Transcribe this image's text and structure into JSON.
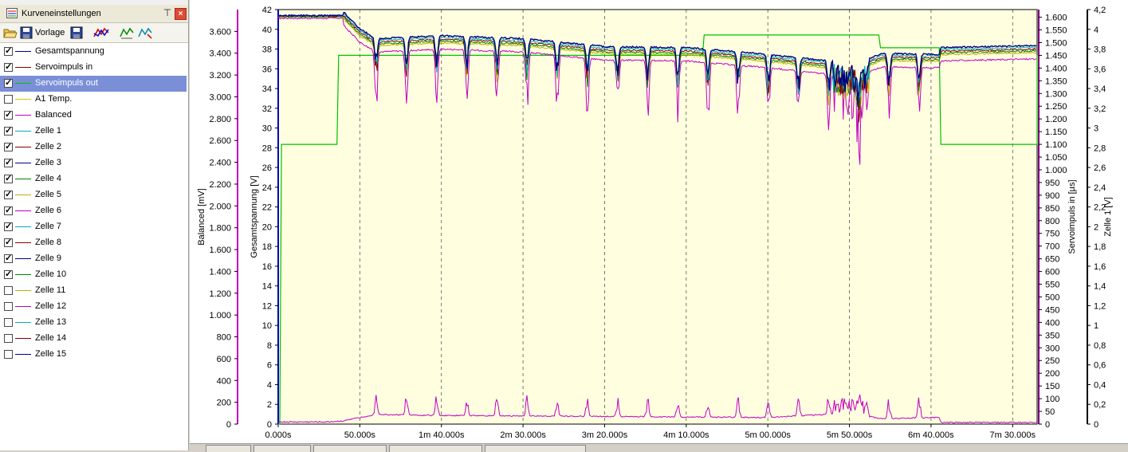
{
  "panel": {
    "title": "Kurveneinstellungen",
    "template_label": "Vorlage",
    "curves": [
      {
        "label": "Gesamtspannung",
        "checked": true,
        "color": "#000080"
      },
      {
        "label": "Servoimpuls in",
        "checked": true,
        "color": "#800000"
      },
      {
        "label": "Servoimpuls out",
        "checked": true,
        "color": "#00c000",
        "selected": true
      },
      {
        "label": "A1 Temp.",
        "checked": false,
        "color": "#e0c000"
      },
      {
        "label": "Balanced",
        "checked": true,
        "color": "#c000c0"
      },
      {
        "label": "Zelle 1",
        "checked": true,
        "color": "#00b0c0"
      },
      {
        "label": "Zelle 2",
        "checked": true,
        "color": "#800000"
      },
      {
        "label": "Zelle 3",
        "checked": true,
        "color": "#000080"
      },
      {
        "label": "Zelle 4",
        "checked": true,
        "color": "#008000"
      },
      {
        "label": "Zelle 5",
        "checked": true,
        "color": "#c0b000"
      },
      {
        "label": "Zelle 6",
        "checked": true,
        "color": "#c000c0"
      },
      {
        "label": "Zelle 7",
        "checked": true,
        "color": "#00b0c0"
      },
      {
        "label": "Zelle 8",
        "checked": true,
        "color": "#800000"
      },
      {
        "label": "Zelle 9",
        "checked": true,
        "color": "#000080"
      },
      {
        "label": "Zelle 10",
        "checked": true,
        "color": "#008000"
      },
      {
        "label": "Zelle 11",
        "checked": false,
        "color": "#c0b000"
      },
      {
        "label": "Zelle 12",
        "checked": false,
        "color": "#c000c0"
      },
      {
        "label": "Zelle 13",
        "checked": false,
        "color": "#00b0c0"
      },
      {
        "label": "Zelle 14",
        "checked": false,
        "color": "#800000"
      },
      {
        "label": "Zelle 15",
        "checked": false,
        "color": "#000080"
      }
    ]
  },
  "chart_data": {
    "type": "line",
    "background": "#ffffe0",
    "grid": "vertical dashed",
    "x_range": [
      0,
      465
    ],
    "x_ticks": [
      {
        "t": 0,
        "label": "0.000s"
      },
      {
        "t": 50,
        "label": "50.000s"
      },
      {
        "t": 100,
        "label": "1m 40.000s"
      },
      {
        "t": 150,
        "label": "2m 30.000s"
      },
      {
        "t": 200,
        "label": "3m 20.000s"
      },
      {
        "t": 250,
        "label": "4m 10.000s"
      },
      {
        "t": 300,
        "label": "5m 00.000s"
      },
      {
        "t": 350,
        "label": "5m 50.000s"
      },
      {
        "t": 400,
        "label": "6m 40.000s"
      },
      {
        "t": 450,
        "label": "7m 30.000s"
      }
    ],
    "axes": {
      "balanced": {
        "label": "Balanced [mV]",
        "range": [
          0,
          3800
        ],
        "color": "#c000c0",
        "ticks": [
          "0",
          "200",
          "400",
          "600",
          "800",
          "1.000",
          "1.200",
          "1.400",
          "1.600",
          "1.800",
          "2.000",
          "2.200",
          "2.400",
          "2.600",
          "2.800",
          "3.000",
          "3.200",
          "3.400",
          "3.600"
        ]
      },
      "gesamt": {
        "label": "Gesamtspannung [V]",
        "range": [
          0,
          42
        ],
        "color": "#0000c0",
        "ticks": [
          "0",
          "2",
          "4",
          "6",
          "8",
          "10",
          "12",
          "14",
          "16",
          "18",
          "20",
          "22",
          "24",
          "26",
          "28",
          "30",
          "32",
          "34",
          "36",
          "38",
          "40",
          "42"
        ]
      },
      "servo": {
        "label": "Servoimpuls in [µs]",
        "range": [
          0,
          1630
        ],
        "color": "#800080",
        "ticks": [
          "0",
          "50",
          "100",
          "150",
          "200",
          "250",
          "300",
          "350",
          "400",
          "450",
          "500",
          "550",
          "600",
          "650",
          "700",
          "750",
          "800",
          "850",
          "900",
          "950",
          "1.000",
          "1.050",
          "1.100",
          "1.150",
          "1.200",
          "1.250",
          "1.300",
          "1.350",
          "1.400",
          "1.450",
          "1.500",
          "1.550",
          "1.600"
        ]
      },
      "zelle": {
        "label": "Zelle 1 [V]",
        "range": [
          0,
          4.2
        ],
        "color": "#000000",
        "ticks": [
          "0",
          "0,2",
          "0,4",
          "0,6",
          "0,8",
          "1",
          "1,2",
          "1,4",
          "1,6",
          "1,8",
          "2",
          "2,2",
          "2,4",
          "2,6",
          "2,8",
          "3",
          "3,2",
          "3,4",
          "3,6",
          "3,8",
          "4",
          "4,2"
        ]
      }
    },
    "series": [
      {
        "name": "Servoimpuls out",
        "axis": "servo",
        "color": "#00c000",
        "points": [
          [
            0,
            0
          ],
          [
            1,
            0
          ],
          [
            2,
            1100
          ],
          [
            36,
            1100
          ],
          [
            37,
            1450
          ],
          [
            260,
            1450
          ],
          [
            261,
            1530
          ],
          [
            368,
            1530
          ],
          [
            369,
            1480
          ],
          [
            405,
            1480
          ],
          [
            406,
            1100
          ],
          [
            465,
            1100
          ],
          [
            465,
            1450
          ]
        ]
      },
      {
        "name": "Gesamtspannung",
        "axis": "gesamt",
        "color": "#000080",
        "base": [
          [
            0,
            41.3
          ],
          [
            40,
            41.3
          ],
          [
            50,
            39.6
          ],
          [
            60,
            38.6
          ],
          [
            100,
            38.9
          ],
          [
            150,
            38.6
          ],
          [
            200,
            37.8
          ],
          [
            250,
            37.7
          ],
          [
            300,
            37.0
          ],
          [
            340,
            36.3
          ],
          [
            355,
            36.1
          ],
          [
            370,
            37.1
          ],
          [
            405,
            37.0
          ],
          [
            406,
            37.7
          ],
          [
            465,
            37.9
          ]
        ],
        "dip_depth": 1.6
      },
      {
        "name": "Balanced",
        "axis": "balanced",
        "color": "#c000c0",
        "base": [
          [
            0,
            20
          ],
          [
            30,
            20
          ],
          [
            40,
            30
          ],
          [
            60,
            90
          ],
          [
            90,
            80
          ],
          [
            200,
            70
          ],
          [
            300,
            60
          ],
          [
            350,
            100
          ],
          [
            370,
            50
          ],
          [
            405,
            60
          ],
          [
            406,
            15
          ],
          [
            465,
            15
          ]
        ],
        "spike_height": 120
      }
    ]
  }
}
